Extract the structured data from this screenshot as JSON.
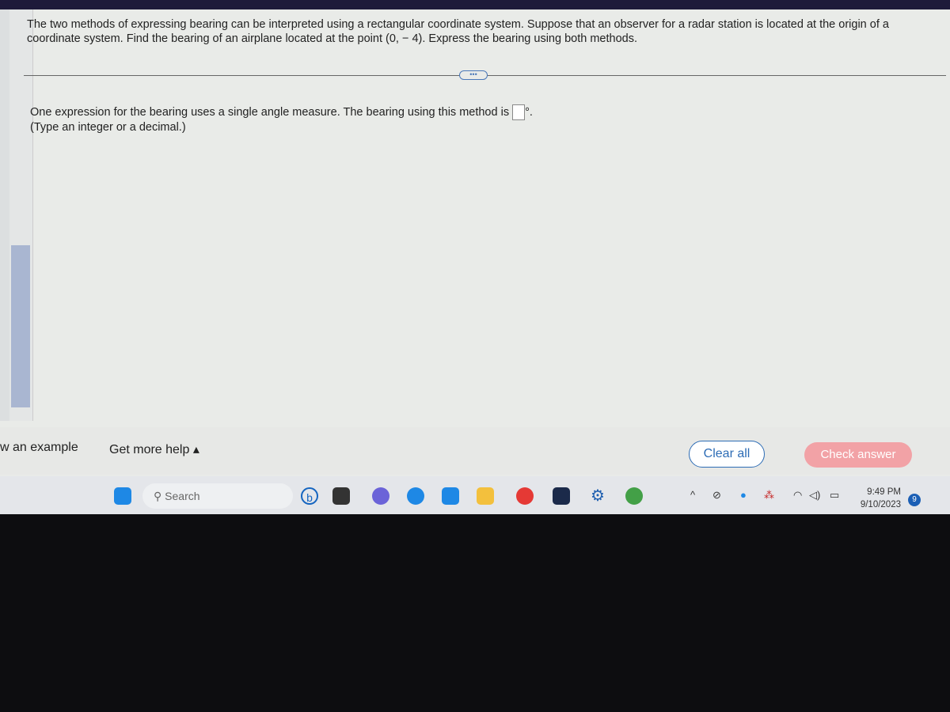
{
  "question": {
    "text": "The two methods of expressing bearing can be interpreted using a rectangular coordinate system. Suppose that an observer for a radar station is located at the origin of a coordinate system. Find the bearing of an airplane located at the point (0, − 4). Express the bearing using both methods.",
    "more_label": "•••",
    "part_text": "One expression for the bearing uses a single angle measure. The bearing using this method is",
    "answer_value": "",
    "degree_symbol": "°.",
    "hint": "(Type an integer or a decimal.)"
  },
  "footer": {
    "example": "w an example",
    "help": "Get more help ▴",
    "clear": "Clear all",
    "check": "Check answer"
  },
  "taskbar": {
    "search": "Search",
    "time": "9:49 PM",
    "date": "9/10/2023",
    "notifications": "9"
  },
  "colors": {
    "accent": "#2d6cb5",
    "check_button": "#f2a2a6"
  }
}
